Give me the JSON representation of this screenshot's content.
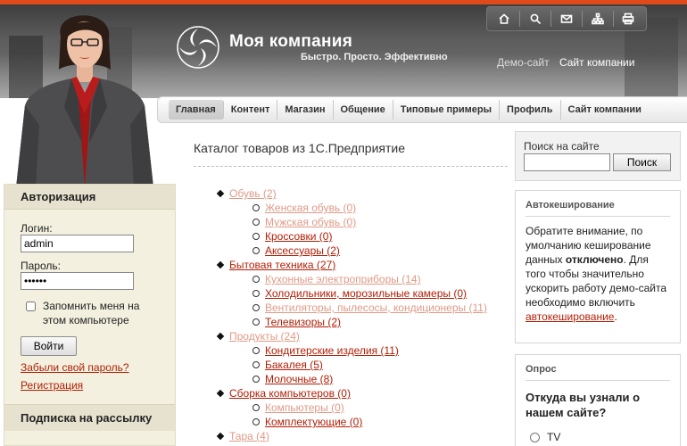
{
  "header": {
    "company_name": "Моя компания",
    "slogan": "Быстро. Просто. Эффективно",
    "links": {
      "demo": "Демо-сайт",
      "site": "Сайт компании"
    },
    "icons": [
      "home-icon",
      "search-icon",
      "mail-icon",
      "sitemap-icon",
      "print-icon"
    ],
    "accent_color": "#e1491d"
  },
  "nav": {
    "tabs": [
      {
        "label": "Главная",
        "active": true
      },
      {
        "label": "Контент"
      },
      {
        "label": "Магазин"
      },
      {
        "label": "Общение"
      },
      {
        "label": "Типовые примеры"
      },
      {
        "label": "Профиль"
      },
      {
        "label": "Сайт компании"
      }
    ]
  },
  "auth": {
    "title": "Авторизация",
    "login_label": "Логин:",
    "login_value": "admin",
    "password_label": "Пароль:",
    "password_value": "******",
    "remember_label": "Запомнить меня на этом компьютере",
    "button": "Войти",
    "forgot_link": "Забыли свой пароль?",
    "register_link": "Регистрация"
  },
  "subscribe": {
    "title": "Подписка на рассылку"
  },
  "content": {
    "title": "Каталог товаров из 1С.Предприятие",
    "catalog": [
      {
        "label": "Обувь (2)",
        "style": "dim",
        "children": [
          {
            "label": "Женская обувь (0)",
            "style": "dim"
          },
          {
            "label": "Мужская обувь (0)",
            "style": "dim"
          },
          {
            "label": "Кроссовки (0)",
            "style": "act"
          },
          {
            "label": "Аксессуары (2)",
            "style": "act"
          }
        ]
      },
      {
        "label": "Бытовая техника (27)",
        "style": "act",
        "children": [
          {
            "label": "Кухонные электроприборы (14)",
            "style": "dim"
          },
          {
            "label": "Холодильники, морозильные камеры (0)",
            "style": "act"
          },
          {
            "label": "Вентиляторы, пылесосы, кондиционеры (11)",
            "style": "dim"
          },
          {
            "label": "Телевизоры (2)",
            "style": "act"
          }
        ]
      },
      {
        "label": "Продукты (24)",
        "style": "dim",
        "children": [
          {
            "label": "Кондитерские изделия (11)",
            "style": "act"
          },
          {
            "label": "Бакалея (5)",
            "style": "act"
          },
          {
            "label": "Молочные (8)",
            "style": "act"
          }
        ]
      },
      {
        "label": "Сборка компьютеров (0)",
        "style": "act",
        "children": [
          {
            "label": "Компьютеры (0)",
            "style": "dim"
          },
          {
            "label": "Комплектующие (0)",
            "style": "act"
          }
        ]
      },
      {
        "label": "Тара (4)",
        "style": "dim",
        "children": []
      }
    ]
  },
  "search": {
    "label": "Поиск на сайте",
    "value": "",
    "button": "Поиск"
  },
  "cache": {
    "title": "Автокеширование",
    "text_1": "Обратите внимание, по умолчанию кеширование данных ",
    "text_bold": "отключено",
    "text_2": ". Для того чтобы значительно ускорить работу демо-сайта необходимо включить ",
    "link": "автокеширование",
    "text_3": "."
  },
  "poll": {
    "title": "Опрос",
    "question": "Откуда вы узнали о нашем сайте?",
    "options": [
      "TV"
    ]
  }
}
